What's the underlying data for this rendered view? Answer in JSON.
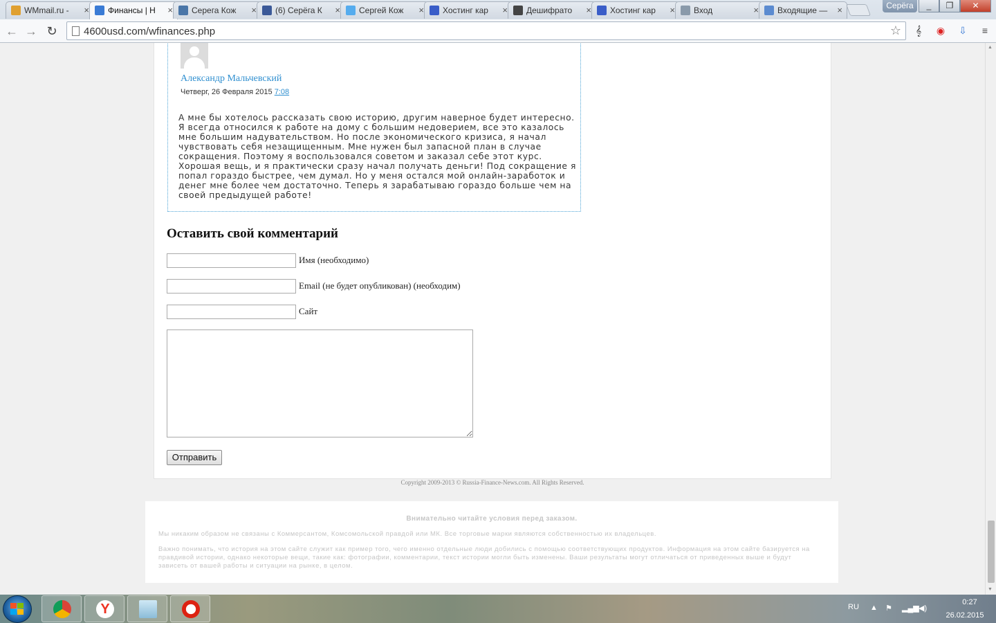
{
  "browser": {
    "tabs": [
      {
        "label": "WMmail.ru -",
        "icon": "wmmail-icon",
        "color": "#e0a030"
      },
      {
        "label": "Финансы | Н",
        "icon": "finance-site-icon",
        "color": "#3a7bd5"
      },
      {
        "label": "Серега Кож",
        "icon": "vk-icon",
        "color": "#4a76a8"
      },
      {
        "label": "(6) Серёга К",
        "icon": "facebook-icon",
        "color": "#3b5998"
      },
      {
        "label": "Сергей Кож",
        "icon": "twitter-icon",
        "color": "#55acee"
      },
      {
        "label": "Хостинг кар",
        "icon": "k-site-icon",
        "color": "#3a5dc8"
      },
      {
        "label": "Дешифрато",
        "icon": "decoder-icon",
        "color": "#444444"
      },
      {
        "label": "Хостинг кар",
        "icon": "k-site-icon",
        "color": "#3a5dc8"
      },
      {
        "label": "Вход",
        "icon": "login-icon",
        "color": "#8a9aaa"
      },
      {
        "label": "Входящие —",
        "icon": "mail-icon",
        "color": "#5b8bd0"
      }
    ],
    "active_tab_index": 1,
    "profile_name": "Серёга",
    "url": "4600usd.com/wfinances.php"
  },
  "comment": {
    "author": "Александр Мальчевский",
    "date": "Четверг, 26 Февраля 2015",
    "time": "7:08",
    "body": "А мне бы хотелось рассказать свою историю, другим наверное будет интересно. Я всегда относился к работе на дому с большим недоверием, все это казалось мне большим надувательством. Но после экономического кризиса, я начал чувствовать себя незащищенным. Мне нужен был запасной план в случае сокращения. Поэтому я воспользовался советом и заказал себе этот курс. Хорошая вещь, и я практически сразу начал получать деньги! Под сокращение я попал гораздо быстрее, чем думал. Но у меня остался мой онлайн-заработок и денег мне более чем достаточно. Теперь я зарабатываю гораздо больше чем на своей предыдущей работе!"
  },
  "form": {
    "title": "Оставить свой комментарий",
    "name_label": "Имя (необходимо)",
    "name_value": "",
    "email_label": "Email (не будет опубликован) (необходим)",
    "email_value": "",
    "site_label": "Сайт",
    "site_value": "",
    "comment_value": "",
    "submit_label": "Отправить"
  },
  "footer": {
    "copyright": "Copyright 2009-2013 © Russia-Finance-News.com. All Rights Reserved.",
    "disclaimer_title": "Внимательно читайте условия перед заказом.",
    "disclaimer_p1": "Мы никаким образом не связаны с Коммерсантом, Комсомольской правдой или МК. Все торговые марки являются собственностью их владельцев.",
    "disclaimer_p2": "Важно понимать, что история на этом сайте служит как пример того, чего именно отдельные люди добились с помощью соответствующих продуктов. Информация на этом сайте базируется на правдивой истории, однако некоторые вещи, такие как: фотографии, комментарии, текст истории могли быть изменены. Ваши результаты могут отличаться от приведенных выше и будут зависеть от вашей работы и ситуации на рынке, в целом."
  },
  "taskbar": {
    "apps": [
      "chrome-icon",
      "yandex-browser-icon",
      "notepad-icon",
      "opera-icon"
    ],
    "language": "RU",
    "time": "0:27",
    "date": "26.02.2015"
  }
}
